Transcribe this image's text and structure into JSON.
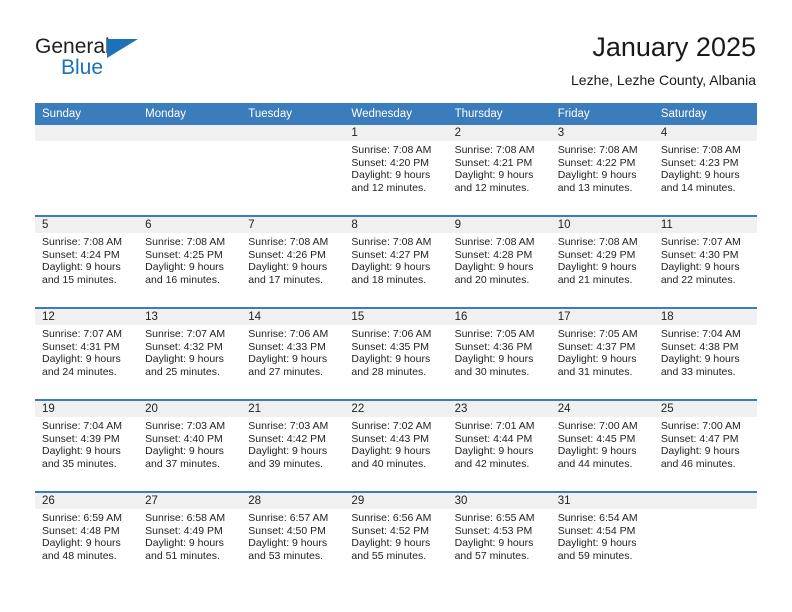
{
  "brand": {
    "word_general": "General",
    "word_blue": "Blue"
  },
  "header": {
    "month_title": "January 2025",
    "location": "Lezhe, Lezhe County, Albania"
  },
  "calendar": {
    "weekday_headers": [
      "Sunday",
      "Monday",
      "Tuesday",
      "Wednesday",
      "Thursday",
      "Friday",
      "Saturday"
    ],
    "accent_color": "#3b7cbd",
    "daynum_band_color": "#f0f0f0",
    "weeks": [
      [
        {
          "day": "",
          "sunrise": "",
          "sunset": "",
          "daylight_line1": "",
          "daylight_line2": ""
        },
        {
          "day": "",
          "sunrise": "",
          "sunset": "",
          "daylight_line1": "",
          "daylight_line2": ""
        },
        {
          "day": "",
          "sunrise": "",
          "sunset": "",
          "daylight_line1": "",
          "daylight_line2": ""
        },
        {
          "day": "1",
          "sunrise": "Sunrise: 7:08 AM",
          "sunset": "Sunset: 4:20 PM",
          "daylight_line1": "Daylight: 9 hours",
          "daylight_line2": "and 12 minutes."
        },
        {
          "day": "2",
          "sunrise": "Sunrise: 7:08 AM",
          "sunset": "Sunset: 4:21 PM",
          "daylight_line1": "Daylight: 9 hours",
          "daylight_line2": "and 12 minutes."
        },
        {
          "day": "3",
          "sunrise": "Sunrise: 7:08 AM",
          "sunset": "Sunset: 4:22 PM",
          "daylight_line1": "Daylight: 9 hours",
          "daylight_line2": "and 13 minutes."
        },
        {
          "day": "4",
          "sunrise": "Sunrise: 7:08 AM",
          "sunset": "Sunset: 4:23 PM",
          "daylight_line1": "Daylight: 9 hours",
          "daylight_line2": "and 14 minutes."
        }
      ],
      [
        {
          "day": "5",
          "sunrise": "Sunrise: 7:08 AM",
          "sunset": "Sunset: 4:24 PM",
          "daylight_line1": "Daylight: 9 hours",
          "daylight_line2": "and 15 minutes."
        },
        {
          "day": "6",
          "sunrise": "Sunrise: 7:08 AM",
          "sunset": "Sunset: 4:25 PM",
          "daylight_line1": "Daylight: 9 hours",
          "daylight_line2": "and 16 minutes."
        },
        {
          "day": "7",
          "sunrise": "Sunrise: 7:08 AM",
          "sunset": "Sunset: 4:26 PM",
          "daylight_line1": "Daylight: 9 hours",
          "daylight_line2": "and 17 minutes."
        },
        {
          "day": "8",
          "sunrise": "Sunrise: 7:08 AM",
          "sunset": "Sunset: 4:27 PM",
          "daylight_line1": "Daylight: 9 hours",
          "daylight_line2": "and 18 minutes."
        },
        {
          "day": "9",
          "sunrise": "Sunrise: 7:08 AM",
          "sunset": "Sunset: 4:28 PM",
          "daylight_line1": "Daylight: 9 hours",
          "daylight_line2": "and 20 minutes."
        },
        {
          "day": "10",
          "sunrise": "Sunrise: 7:08 AM",
          "sunset": "Sunset: 4:29 PM",
          "daylight_line1": "Daylight: 9 hours",
          "daylight_line2": "and 21 minutes."
        },
        {
          "day": "11",
          "sunrise": "Sunrise: 7:07 AM",
          "sunset": "Sunset: 4:30 PM",
          "daylight_line1": "Daylight: 9 hours",
          "daylight_line2": "and 22 minutes."
        }
      ],
      [
        {
          "day": "12",
          "sunrise": "Sunrise: 7:07 AM",
          "sunset": "Sunset: 4:31 PM",
          "daylight_line1": "Daylight: 9 hours",
          "daylight_line2": "and 24 minutes."
        },
        {
          "day": "13",
          "sunrise": "Sunrise: 7:07 AM",
          "sunset": "Sunset: 4:32 PM",
          "daylight_line1": "Daylight: 9 hours",
          "daylight_line2": "and 25 minutes."
        },
        {
          "day": "14",
          "sunrise": "Sunrise: 7:06 AM",
          "sunset": "Sunset: 4:33 PM",
          "daylight_line1": "Daylight: 9 hours",
          "daylight_line2": "and 27 minutes."
        },
        {
          "day": "15",
          "sunrise": "Sunrise: 7:06 AM",
          "sunset": "Sunset: 4:35 PM",
          "daylight_line1": "Daylight: 9 hours",
          "daylight_line2": "and 28 minutes."
        },
        {
          "day": "16",
          "sunrise": "Sunrise: 7:05 AM",
          "sunset": "Sunset: 4:36 PM",
          "daylight_line1": "Daylight: 9 hours",
          "daylight_line2": "and 30 minutes."
        },
        {
          "day": "17",
          "sunrise": "Sunrise: 7:05 AM",
          "sunset": "Sunset: 4:37 PM",
          "daylight_line1": "Daylight: 9 hours",
          "daylight_line2": "and 31 minutes."
        },
        {
          "day": "18",
          "sunrise": "Sunrise: 7:04 AM",
          "sunset": "Sunset: 4:38 PM",
          "daylight_line1": "Daylight: 9 hours",
          "daylight_line2": "and 33 minutes."
        }
      ],
      [
        {
          "day": "19",
          "sunrise": "Sunrise: 7:04 AM",
          "sunset": "Sunset: 4:39 PM",
          "daylight_line1": "Daylight: 9 hours",
          "daylight_line2": "and 35 minutes."
        },
        {
          "day": "20",
          "sunrise": "Sunrise: 7:03 AM",
          "sunset": "Sunset: 4:40 PM",
          "daylight_line1": "Daylight: 9 hours",
          "daylight_line2": "and 37 minutes."
        },
        {
          "day": "21",
          "sunrise": "Sunrise: 7:03 AM",
          "sunset": "Sunset: 4:42 PM",
          "daylight_line1": "Daylight: 9 hours",
          "daylight_line2": "and 39 minutes."
        },
        {
          "day": "22",
          "sunrise": "Sunrise: 7:02 AM",
          "sunset": "Sunset: 4:43 PM",
          "daylight_line1": "Daylight: 9 hours",
          "daylight_line2": "and 40 minutes."
        },
        {
          "day": "23",
          "sunrise": "Sunrise: 7:01 AM",
          "sunset": "Sunset: 4:44 PM",
          "daylight_line1": "Daylight: 9 hours",
          "daylight_line2": "and 42 minutes."
        },
        {
          "day": "24",
          "sunrise": "Sunrise: 7:00 AM",
          "sunset": "Sunset: 4:45 PM",
          "daylight_line1": "Daylight: 9 hours",
          "daylight_line2": "and 44 minutes."
        },
        {
          "day": "25",
          "sunrise": "Sunrise: 7:00 AM",
          "sunset": "Sunset: 4:47 PM",
          "daylight_line1": "Daylight: 9 hours",
          "daylight_line2": "and 46 minutes."
        }
      ],
      [
        {
          "day": "26",
          "sunrise": "Sunrise: 6:59 AM",
          "sunset": "Sunset: 4:48 PM",
          "daylight_line1": "Daylight: 9 hours",
          "daylight_line2": "and 48 minutes."
        },
        {
          "day": "27",
          "sunrise": "Sunrise: 6:58 AM",
          "sunset": "Sunset: 4:49 PM",
          "daylight_line1": "Daylight: 9 hours",
          "daylight_line2": "and 51 minutes."
        },
        {
          "day": "28",
          "sunrise": "Sunrise: 6:57 AM",
          "sunset": "Sunset: 4:50 PM",
          "daylight_line1": "Daylight: 9 hours",
          "daylight_line2": "and 53 minutes."
        },
        {
          "day": "29",
          "sunrise": "Sunrise: 6:56 AM",
          "sunset": "Sunset: 4:52 PM",
          "daylight_line1": "Daylight: 9 hours",
          "daylight_line2": "and 55 minutes."
        },
        {
          "day": "30",
          "sunrise": "Sunrise: 6:55 AM",
          "sunset": "Sunset: 4:53 PM",
          "daylight_line1": "Daylight: 9 hours",
          "daylight_line2": "and 57 minutes."
        },
        {
          "day": "31",
          "sunrise": "Sunrise: 6:54 AM",
          "sunset": "Sunset: 4:54 PM",
          "daylight_line1": "Daylight: 9 hours",
          "daylight_line2": "and 59 minutes."
        },
        {
          "day": "",
          "sunrise": "",
          "sunset": "",
          "daylight_line1": "",
          "daylight_line2": ""
        }
      ]
    ]
  }
}
